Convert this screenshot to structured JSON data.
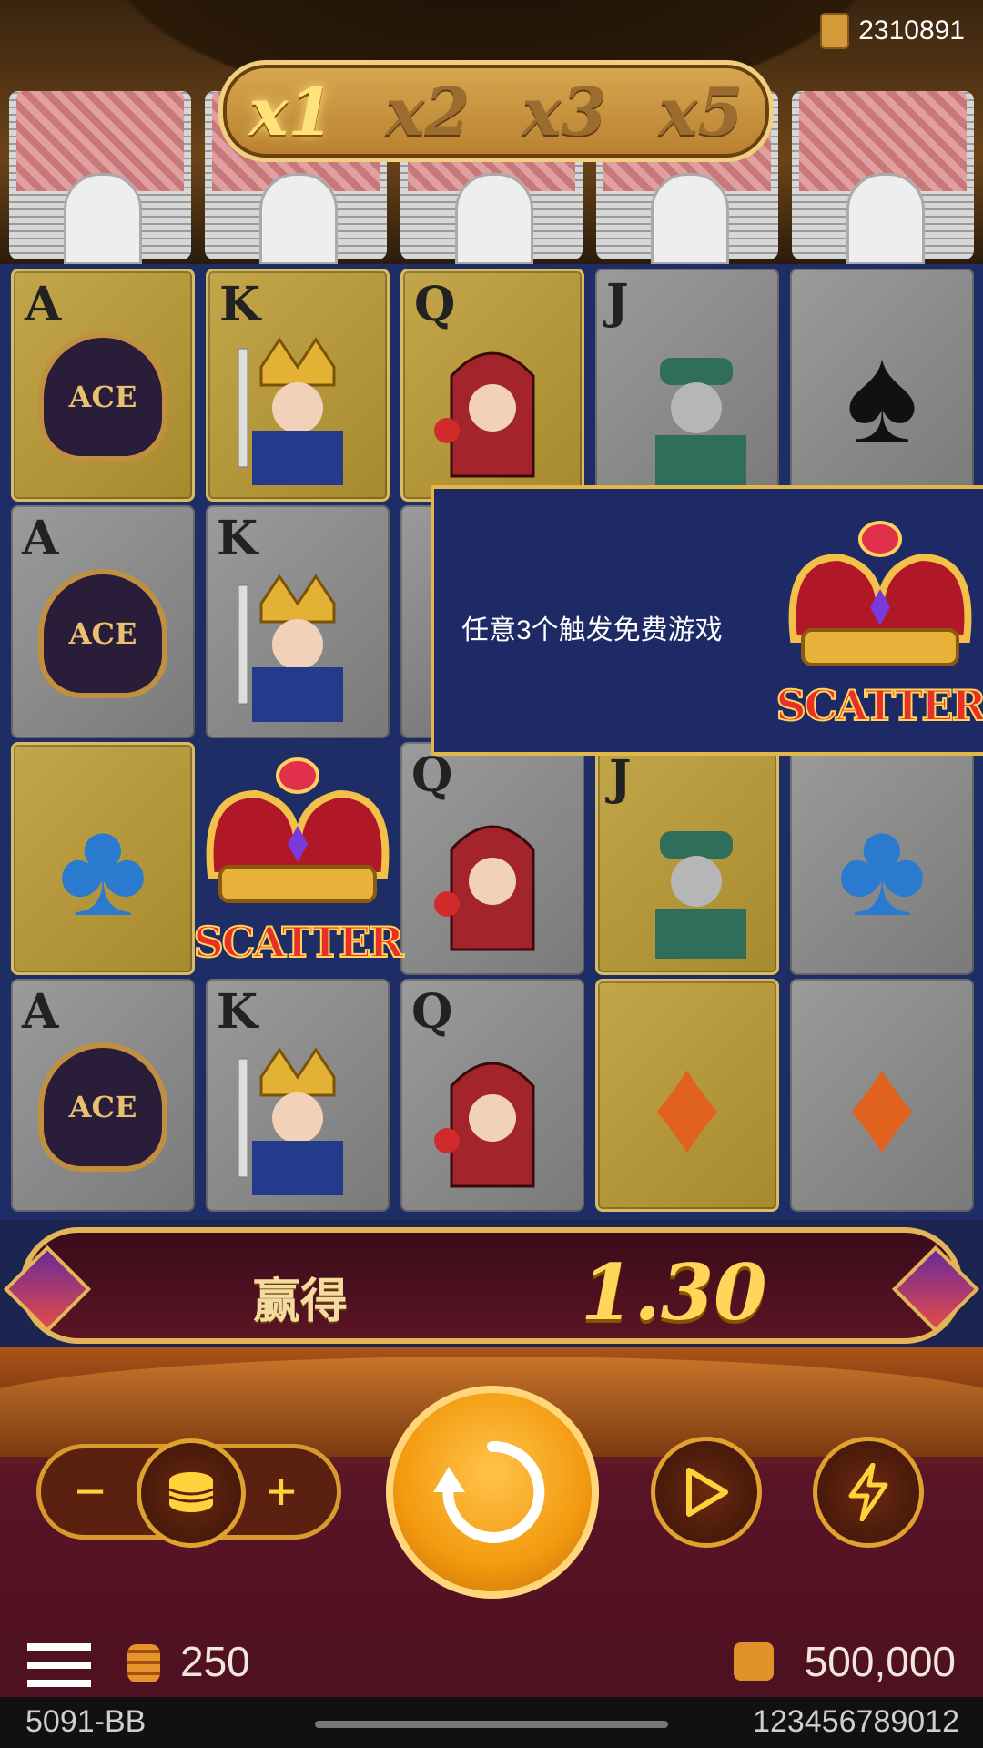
{
  "header": {
    "jackpot": "2310891",
    "multipliers": [
      {
        "label": "x1",
        "active": true
      },
      {
        "label": "x2",
        "active": false
      },
      {
        "label": "x3",
        "active": false
      },
      {
        "label": "x5",
        "active": false
      }
    ]
  },
  "reels": {
    "ranks": {
      "ace": "A",
      "king": "K",
      "queen": "Q",
      "jack": "J"
    },
    "ace_badge": "ACE",
    "scatter_label": "SCATTER",
    "popup_text": "任意3个触发免费游戏"
  },
  "win": {
    "label": "赢得",
    "value": "1.30"
  },
  "controls": {
    "minus": "−",
    "plus": "+"
  },
  "status": {
    "bet": "250",
    "balance": "500,000"
  },
  "footer": {
    "left": "5091-BB",
    "right": "123456789012"
  }
}
